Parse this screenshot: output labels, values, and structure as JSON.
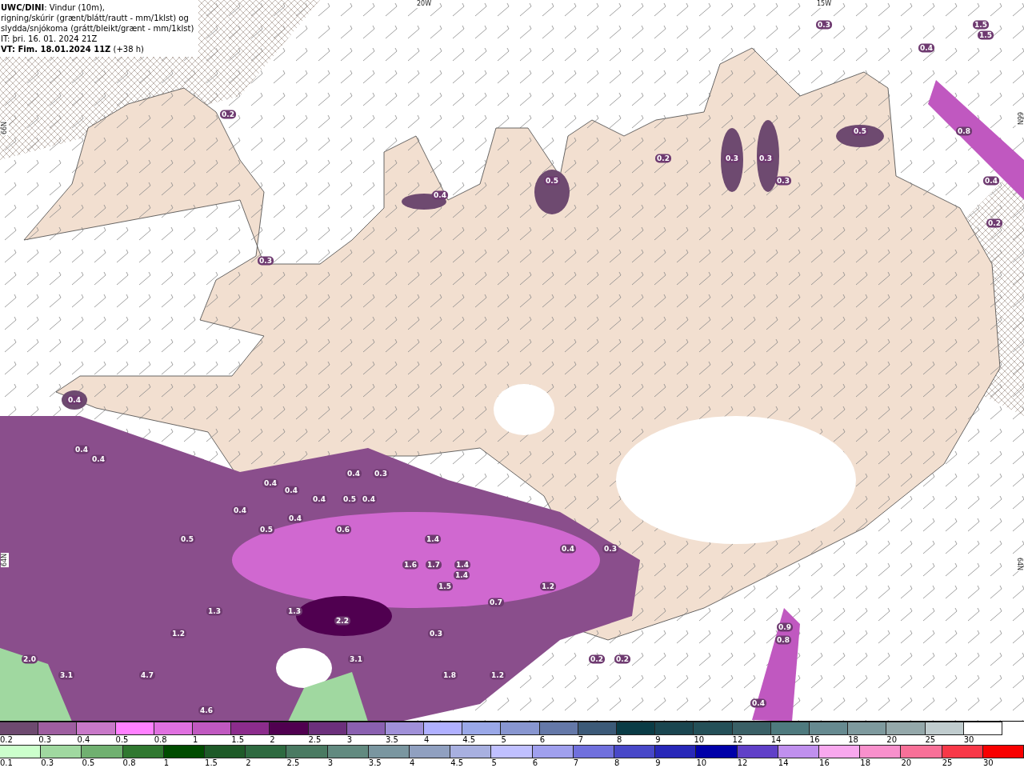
{
  "title_box": {
    "lines": [
      "**UWC/DINI**: Vindur (10m),",
      "rigning/skúrir (grænt/blátt/rautt - mm/1klst) og",
      "slydda/snjókoma (grátt/bleikt/grænt - mm/1klst)",
      "IT: þri. 16. 01. 2024 21Z",
      "**VT: Fim. 18.01.2024 11Z** (+38 h)"
    ]
  },
  "map": {
    "grid_labels": [
      "20W",
      "15W",
      "66N",
      "66N",
      "64N",
      "64N"
    ],
    "value_labels": [
      "0.3",
      "1.5",
      "1.5",
      "0.4",
      "0.2",
      "0.5",
      "0.8",
      "0.2",
      "0.3",
      "0.3",
      "0.5",
      "0.3",
      "0.4",
      "0.4",
      "0.2",
      "0.3",
      "0.4",
      "0.4",
      "0.4",
      "0.4",
      "0.3",
      "0.4",
      "0.4",
      "0.4",
      "0.5",
      "0.4",
      "0.4",
      "0.4",
      "0.5",
      "0.6",
      "0.5",
      "1.4",
      "0.4",
      "0.3",
      "1.6",
      "1.7",
      "1.4",
      "1.4",
      "1.5",
      "1.2",
      "0.7",
      "1.3",
      "1.3",
      "2.2",
      "0.9",
      "1.2",
      "0.3",
      "0.8",
      "2.0",
      "3.1",
      "0.2",
      "0.2",
      "3.1",
      "4.7",
      "1.8",
      "1.2",
      "0.4",
      "4.6"
    ]
  },
  "legends": [
    {
      "swatches": [
        {
          "label": "0.2",
          "color": "#6e4a70"
        },
        {
          "label": "0.3",
          "color": "#9e5ea0"
        },
        {
          "label": "0.4",
          "color": "#c878c8"
        },
        {
          "label": "0.5",
          "color": "#ff80ff"
        },
        {
          "label": "0.8",
          "color": "#e070e0"
        },
        {
          "label": "1",
          "color": "#c058c0"
        },
        {
          "label": "1.5",
          "color": "#8c2c8c"
        },
        {
          "label": "2",
          "color": "#500050"
        },
        {
          "label": "2.5",
          "color": "#6c307c"
        },
        {
          "label": "3",
          "color": "#8a60b0"
        },
        {
          "label": "3.5",
          "color": "#a090d8"
        },
        {
          "label": "4",
          "color": "#b0b0ff"
        },
        {
          "label": "4.5",
          "color": "#9aa8e8"
        },
        {
          "label": "5",
          "color": "#8896d0"
        },
        {
          "label": "6",
          "color": "#6478a8"
        },
        {
          "label": "7",
          "color": "#3c5a78"
        },
        {
          "label": "8",
          "color": "#0a3c46"
        },
        {
          "label": "9",
          "color": "#1a4650"
        },
        {
          "label": "10",
          "color": "#245058"
        },
        {
          "label": "12",
          "color": "#3a6066"
        },
        {
          "label": "14",
          "color": "#4e7a7e"
        },
        {
          "label": "16",
          "color": "#668a90"
        },
        {
          "label": "18",
          "color": "#7e9a9e"
        },
        {
          "label": "20",
          "color": "#94a8aa"
        },
        {
          "label": "25",
          "color": "#c0ccce"
        },
        {
          "label": "30",
          "color": "#ffffff"
        }
      ]
    },
    {
      "swatches": [
        {
          "label": "0.1",
          "color": "#ccffcc"
        },
        {
          "label": "0.3",
          "color": "#a0d8a0"
        },
        {
          "label": "0.5",
          "color": "#70b070"
        },
        {
          "label": "0.8",
          "color": "#307830"
        },
        {
          "label": "1",
          "color": "#004c00"
        },
        {
          "label": "1.5",
          "color": "#1e5a28"
        },
        {
          "label": "2",
          "color": "#2e6a40"
        },
        {
          "label": "2.5",
          "color": "#4a7a62"
        },
        {
          "label": "3",
          "color": "#628a80"
        },
        {
          "label": "3.5",
          "color": "#7a96a0"
        },
        {
          "label": "4",
          "color": "#90a0c0"
        },
        {
          "label": "4.5",
          "color": "#a8b0e0"
        },
        {
          "label": "5",
          "color": "#c0c0ff"
        },
        {
          "label": "6",
          "color": "#a0a0ee"
        },
        {
          "label": "7",
          "color": "#7070dd"
        },
        {
          "label": "8",
          "color": "#4848c8"
        },
        {
          "label": "9",
          "color": "#2828b8"
        },
        {
          "label": "10",
          "color": "#0000a8"
        },
        {
          "label": "12",
          "color": "#6040c8"
        },
        {
          "label": "14",
          "color": "#c090ee"
        },
        {
          "label": "16",
          "color": "#f8a8ee"
        },
        {
          "label": "18",
          "color": "#f890cc"
        },
        {
          "label": "20",
          "color": "#f87098"
        },
        {
          "label": "25",
          "color": "#f83848"
        },
        {
          "label": "30",
          "color": "#f80000"
        }
      ]
    }
  ]
}
